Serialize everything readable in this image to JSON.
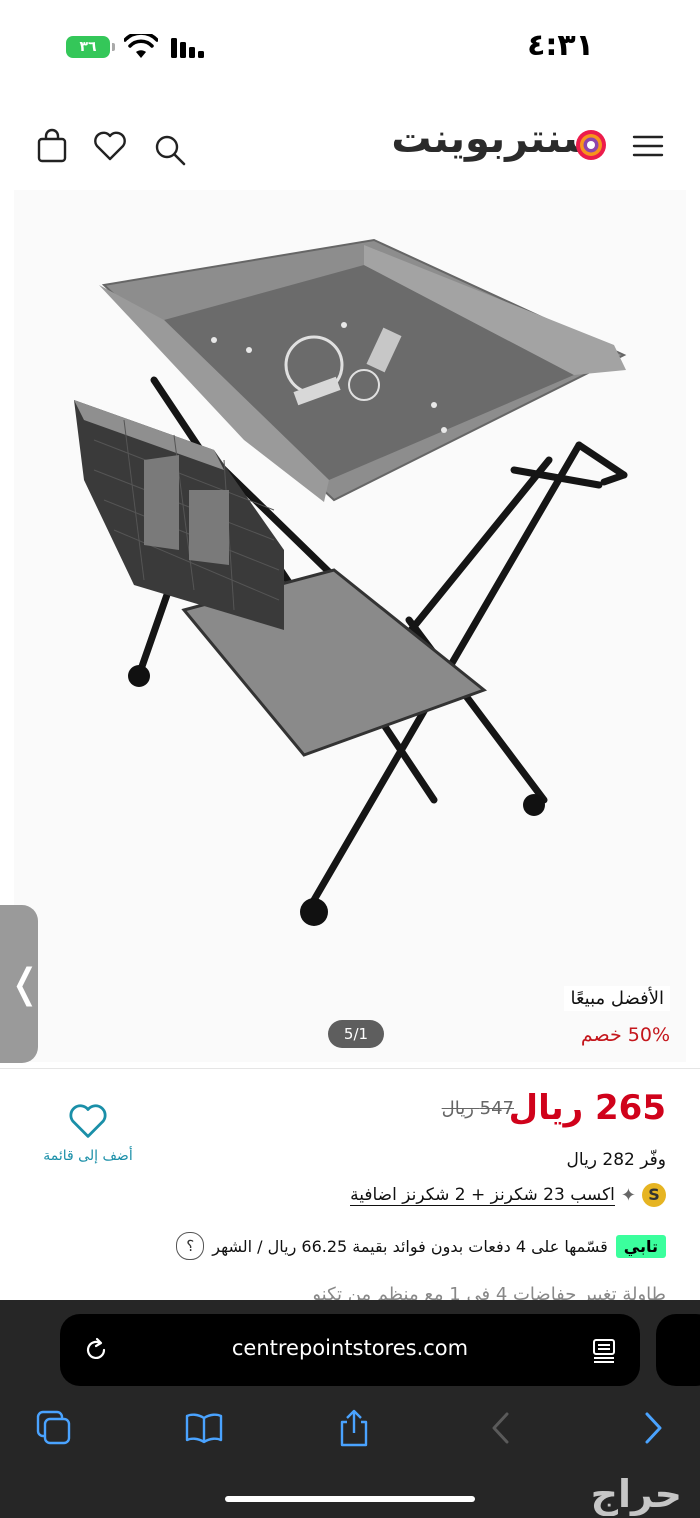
{
  "status_bar": {
    "time": "٤:٣١",
    "battery": "٣٦"
  },
  "header": {
    "logo_text": "سنتربوينت",
    "menu_icon": "hamburger-icon",
    "search_icon": "search-icon",
    "wishlist_icon": "heart-icon",
    "cart_icon": "bag-icon"
  },
  "gallery": {
    "pager": "5/1",
    "badge_bestseller": "الأفضل مبيعًا",
    "badge_discount": "50% خصم"
  },
  "product": {
    "price": "265 ريال",
    "old_price": "547 ريال",
    "savings": "وفّر 282  ريال",
    "shukranz": "اكسب 23 شكرنز +  2 شكرنز اضافية",
    "shukranz_badge": "S",
    "wishlist_label": "أضف إلى قائمة",
    "tabby_badge": "تابي",
    "tabby_text": "قسّمها على 4 دفعات بدون فوائد بقيمة 66.25 ريال / الشهر",
    "help": "؟",
    "title_partial": "طاولة تغيير حفاضات 4 في 1 مع منظم من تكنو"
  },
  "browser": {
    "url": "centrepointstores.com"
  },
  "watermark": "حراج",
  "colors": {
    "price_red": "#d0021b",
    "discount_red": "#c4161c",
    "tabby_green": "#3bff9d",
    "link_teal": "#1a8fa8",
    "browser_bg": "#262626"
  }
}
